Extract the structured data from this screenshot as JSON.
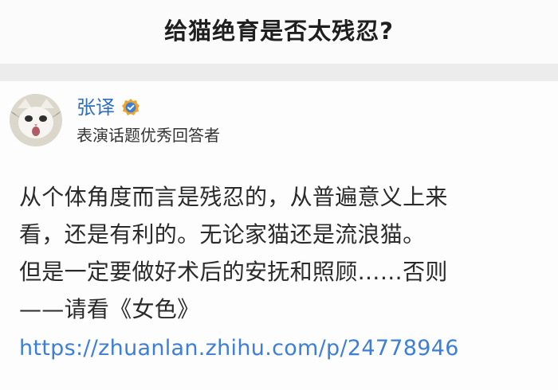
{
  "question": {
    "title": "给猫绝育是否太残忍?"
  },
  "answer": {
    "author_name": "张译",
    "author_title": "表演话题优秀回答者",
    "avatar_icon": "cat-avatar-icon",
    "badge_icon": "verified-badge-icon",
    "badge_color": "#f0a326",
    "lines": [
      "从个体角度而言是残忍的，从普遍意义上来",
      "看，还是有利的。无论家猫还是流浪猫。",
      "但是一定要做好术后的安抚和照顾……否则",
      "——请看《女色》"
    ],
    "link": "https://zhuanlan.zhihu.com/p/24778946"
  },
  "colors": {
    "link": "#3d7fd6",
    "author_name": "#2f6fc0"
  }
}
